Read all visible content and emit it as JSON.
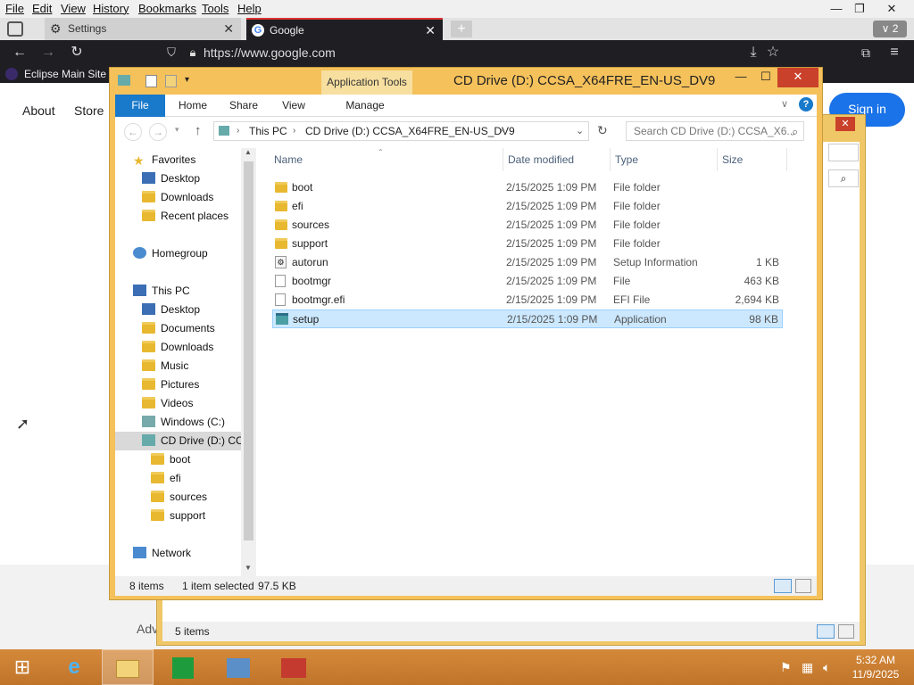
{
  "browser": {
    "menu": [
      "File",
      "Edit",
      "View",
      "History",
      "Bookmarks",
      "Tools",
      "Help"
    ],
    "tabs": [
      {
        "title": "Settings",
        "active": false
      },
      {
        "title": "Google",
        "active": true
      }
    ],
    "tab_count": "2",
    "url": "https://www.google.com",
    "bookmark": "Eclipse Main Site"
  },
  "google": {
    "links": [
      "About",
      "Store"
    ],
    "sign_in": "Sign in",
    "footer_partial": "Adv"
  },
  "explorer2": {
    "status": "5 items"
  },
  "explorer": {
    "title": "CD Drive (D:) CCSA_X64FRE_EN-US_DV9",
    "context_tab": "Application Tools",
    "ribbon_tabs": [
      "File",
      "Home",
      "Share",
      "View",
      "Manage"
    ],
    "breadcrumb": [
      "This PC",
      "CD Drive (D:) CCSA_X64FRE_EN-US_DV9"
    ],
    "search_placeholder": "Search CD Drive (D:) CCSA_X6...",
    "nav": [
      {
        "label": "Favorites",
        "icon": "star-icon"
      },
      {
        "label": "Desktop",
        "icon": "desktop-icon"
      },
      {
        "label": "Downloads",
        "icon": "downloads-icon"
      },
      {
        "label": "Recent places",
        "icon": "recent-places-icon"
      },
      {
        "label": "Homegroup",
        "icon": "homegroup-icon"
      },
      {
        "label": "This PC",
        "icon": "computer-icon"
      },
      {
        "label": "Desktop",
        "icon": "desktop-icon"
      },
      {
        "label": "Documents",
        "icon": "documents-icon"
      },
      {
        "label": "Downloads",
        "icon": "downloads-icon"
      },
      {
        "label": "Music",
        "icon": "music-icon"
      },
      {
        "label": "Pictures",
        "icon": "pictures-icon"
      },
      {
        "label": "Videos",
        "icon": "videos-icon"
      },
      {
        "label": "Windows (C:)",
        "icon": "drive-icon"
      },
      {
        "label": "CD Drive (D:) CCS",
        "icon": "cd-drive-icon"
      },
      {
        "label": "boot",
        "icon": "folder-icon"
      },
      {
        "label": "efi",
        "icon": "folder-icon"
      },
      {
        "label": "sources",
        "icon": "folder-icon"
      },
      {
        "label": "support",
        "icon": "folder-icon"
      },
      {
        "label": "Network",
        "icon": "network-icon"
      }
    ],
    "columns": [
      "Name",
      "Date modified",
      "Type",
      "Size"
    ],
    "files": [
      {
        "name": "boot",
        "date": "2/15/2025 1:09 PM",
        "type": "File folder",
        "size": ""
      },
      {
        "name": "efi",
        "date": "2/15/2025 1:09 PM",
        "type": "File folder",
        "size": ""
      },
      {
        "name": "sources",
        "date": "2/15/2025 1:09 PM",
        "type": "File folder",
        "size": ""
      },
      {
        "name": "support",
        "date": "2/15/2025 1:09 PM",
        "type": "File folder",
        "size": ""
      },
      {
        "name": "autorun",
        "date": "2/15/2025 1:09 PM",
        "type": "Setup Information",
        "size": "1 KB"
      },
      {
        "name": "bootmgr",
        "date": "2/15/2025 1:09 PM",
        "type": "File",
        "size": "463 KB"
      },
      {
        "name": "bootmgr.efi",
        "date": "2/15/2025 1:09 PM",
        "type": "EFI File",
        "size": "2,694 KB"
      },
      {
        "name": "setup",
        "date": "2/15/2025 1:09 PM",
        "type": "Application",
        "size": "98 KB"
      }
    ],
    "selected_file": "setup",
    "status": {
      "items": "8 items",
      "selected": "1 item selected",
      "size": "97.5 KB"
    }
  },
  "taskbar": {
    "time": "5:32 AM",
    "date": "11/9/2025"
  }
}
